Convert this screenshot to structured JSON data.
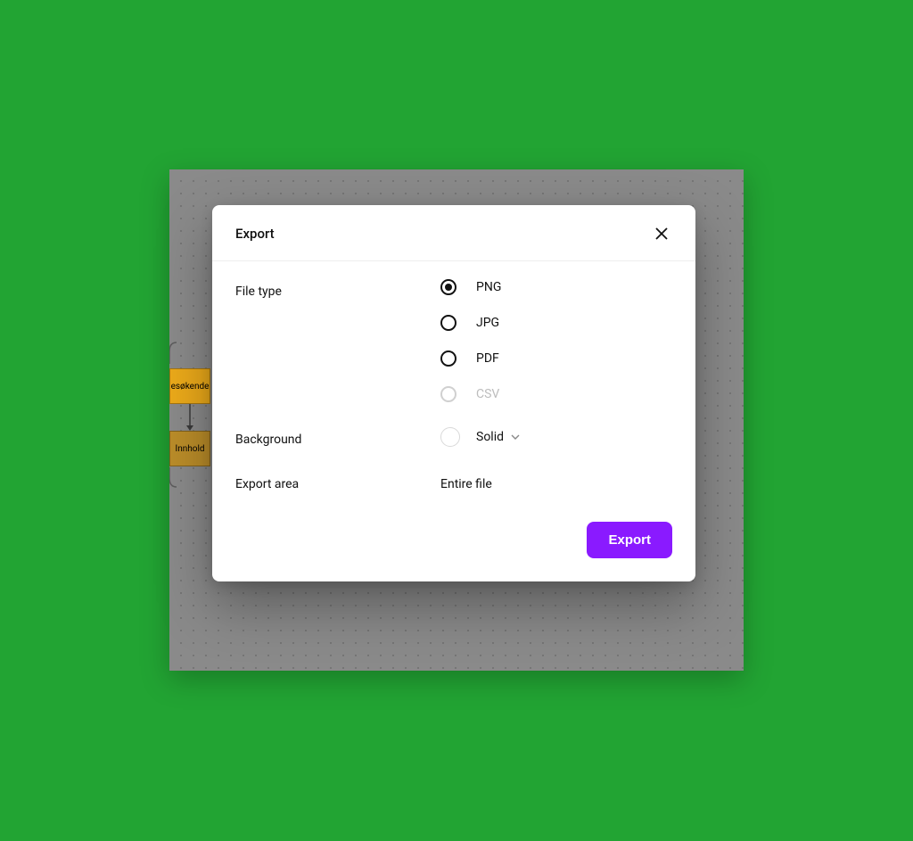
{
  "colors": {
    "page_bg": "#22a433",
    "canvas_bg": "#8a8a8a",
    "node_a_bg": "#ecaa1a",
    "node_b_bg": "#bb8d29",
    "primary_button": "#8a1aff"
  },
  "canvas": {
    "node_a_label": "esøkende",
    "node_b_label": "Innhold"
  },
  "modal": {
    "title": "Export",
    "close_icon": "close",
    "sections": {
      "file_type_label": "File type",
      "background_label": "Background",
      "export_area_label": "Export area"
    },
    "file_type": {
      "selected": "PNG",
      "options": {
        "png": "PNG",
        "jpg": "JPG",
        "pdf": "PDF",
        "csv": "CSV"
      },
      "disabled": [
        "csv"
      ]
    },
    "background": {
      "swatch_color": "#ffffff",
      "value": "Solid"
    },
    "export_area": {
      "value": "Entire file"
    },
    "submit_label": "Export"
  }
}
